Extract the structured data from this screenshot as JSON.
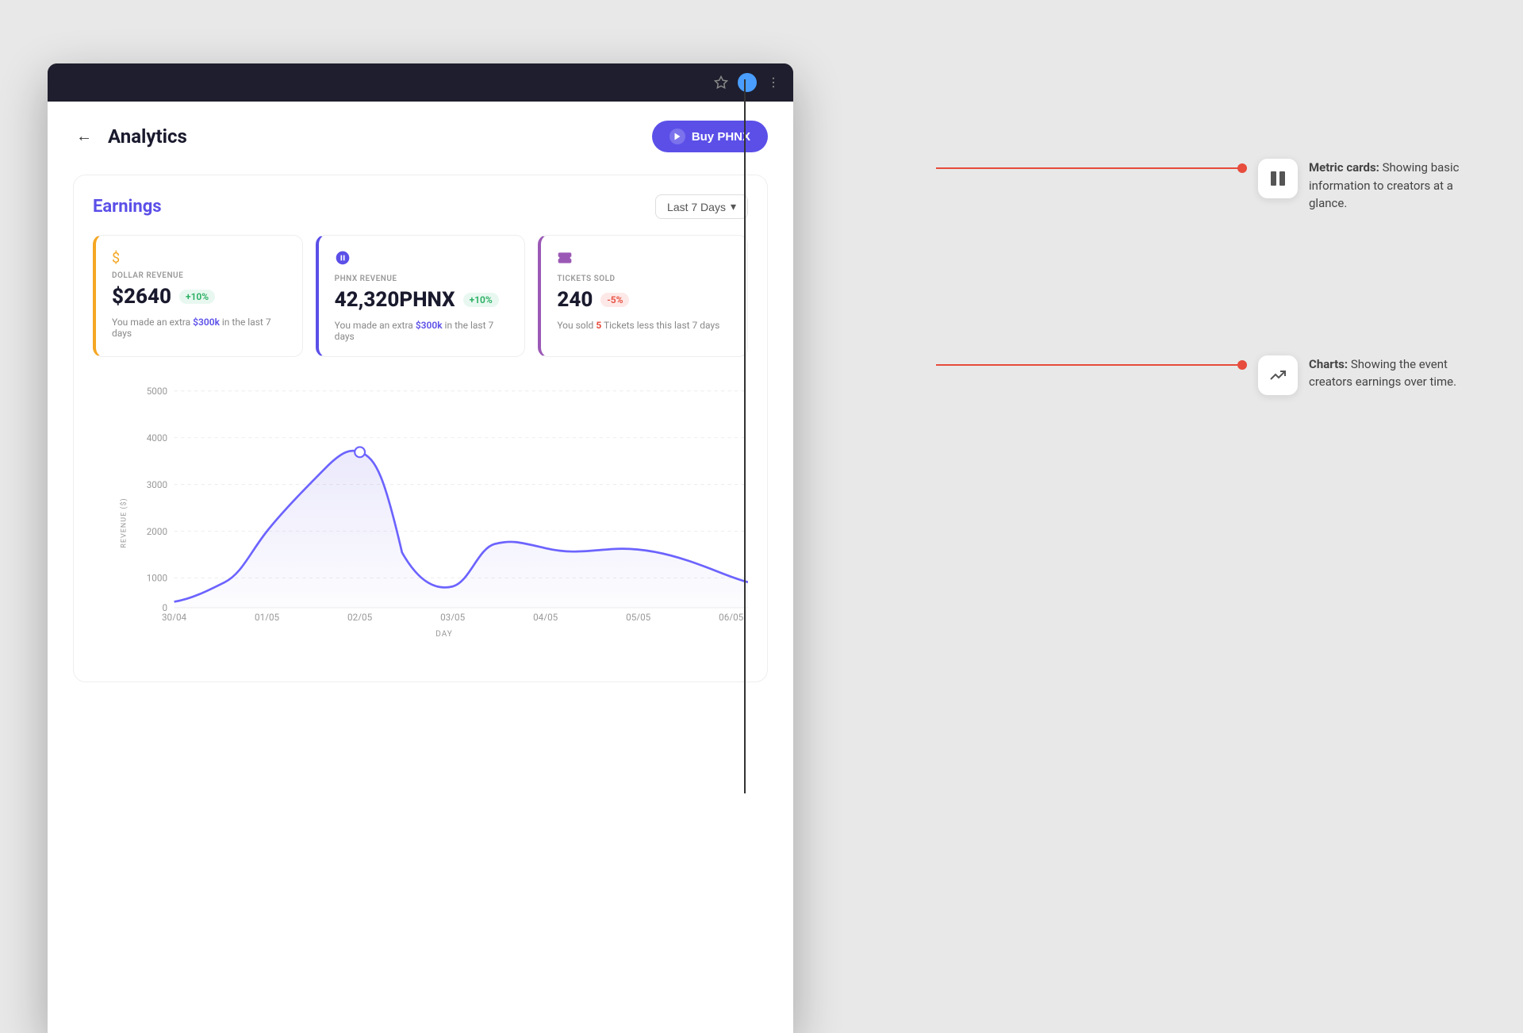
{
  "browser": {
    "title": "Analytics"
  },
  "header": {
    "back_label": "←",
    "title": "Analytics",
    "buy_button": "Buy PHNX"
  },
  "earnings": {
    "title": "Earnings",
    "time_filter": "Last 7 Days",
    "time_filter_arrow": "▾",
    "cards": [
      {
        "id": "dollar",
        "icon": "$",
        "label": "DOLLAR REVENUE",
        "value": "$2640",
        "badge": "+10%",
        "badge_type": "positive",
        "description": "You made an extra ",
        "highlight": "$300k",
        "description_suffix": " in the last 7 days"
      },
      {
        "id": "phnx",
        "icon": "🐦",
        "label": "PHNX REVENUE",
        "value": "42,320PHNX",
        "badge": "+10%",
        "badge_type": "positive",
        "description": "You made an extra ",
        "highlight": "$300k",
        "description_suffix": " in the last 7 days"
      },
      {
        "id": "tickets",
        "icon": "🎫",
        "label": "TICKETS SOLD",
        "value": "240",
        "badge": "-5%",
        "badge_type": "negative",
        "description": "You sold ",
        "highlight": "5",
        "description_suffix": " Tickets less this last 7 days",
        "highlight_class": "red"
      }
    ]
  },
  "chart": {
    "y_label": "REVENUE ($)",
    "x_label": "DAY",
    "y_ticks": [
      "5000",
      "4000",
      "3000",
      "2000",
      "1000",
      "0"
    ],
    "x_ticks": [
      "30/04",
      "01/05",
      "02/05",
      "03/05",
      "04/05",
      "05/05",
      "06/05"
    ]
  },
  "annotations": [
    {
      "id": "metric-cards",
      "icon": "⏸",
      "title": "Metric cards:",
      "description": "Showing basic information to creators at a glance."
    },
    {
      "id": "charts",
      "icon": "↗",
      "title": "Charts:",
      "description": "Showing the event creators earnings over time."
    }
  ]
}
